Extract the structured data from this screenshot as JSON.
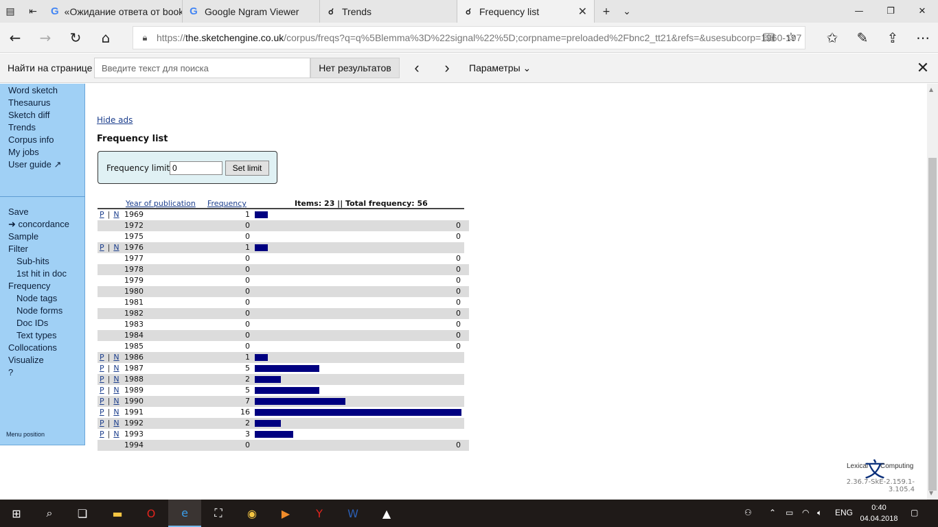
{
  "tabs": [
    {
      "title": "«Ожидание ответа от book",
      "icon": "google-g-icon",
      "active": false
    },
    {
      "title": "Google Ngram Viewer",
      "icon": "google-g-icon",
      "active": false
    },
    {
      "title": "Trends",
      "icon": "sketchengine-icon",
      "active": false
    },
    {
      "title": "Frequency list",
      "icon": "sketchengine-icon",
      "active": true
    }
  ],
  "address": {
    "prefix": "https://",
    "host": "the.sketchengine.co.uk",
    "path": "/corpus/freqs?q=q%5Blemma%3D%22signal%22%5D;corpname=preloaded%2Fbnc2_tt21&refs=&usesubcorp=1960-197"
  },
  "findbar": {
    "label": "Найти на странице",
    "placeholder": "Введите текст для поиска",
    "result": "Нет результатов",
    "options": "Параметры"
  },
  "sidebar": {
    "items": [
      {
        "label": "Word sketch",
        "sub": false
      },
      {
        "label": "Thesaurus",
        "sub": false
      },
      {
        "label": "Sketch diff",
        "sub": false
      },
      {
        "label": "Trends",
        "sub": false
      },
      {
        "label": "Corpus info",
        "sub": false
      },
      {
        "label": "My jobs",
        "sub": false
      },
      {
        "label": "User guide ↗",
        "sub": false
      }
    ],
    "items2": [
      {
        "label": "Save",
        "sub": false
      },
      {
        "label": "➜ concordance",
        "sub": false
      },
      {
        "label": "Sample",
        "sub": false
      },
      {
        "label": "Filter",
        "sub": false
      },
      {
        "label": "Sub-hits",
        "sub": true
      },
      {
        "label": "1st hit in doc",
        "sub": true
      },
      {
        "label": "Frequency",
        "sub": false
      },
      {
        "label": "Node tags",
        "sub": true
      },
      {
        "label": "Node forms",
        "sub": true
      },
      {
        "label": "Doc IDs",
        "sub": true
      },
      {
        "label": "Text types",
        "sub": true
      },
      {
        "label": "Collocations",
        "sub": false
      },
      {
        "label": "Visualize",
        "sub": false
      },
      {
        "label": "?",
        "sub": false
      }
    ],
    "menu_position": "Menu position"
  },
  "page": {
    "hide_ads": "Hide ads",
    "title": "Frequency list",
    "limit_label": "Frequency limit:",
    "limit_value": "0",
    "limit_button": "Set limit"
  },
  "table": {
    "col_year": "Year of publication",
    "col_freq": "Frequency",
    "summary": "Items: 23 || Total frequency: 56",
    "p_label": "P",
    "n_label": "N",
    "max": 16,
    "rows": [
      {
        "year": "1969",
        "freq": 1
      },
      {
        "year": "1972",
        "freq": 0
      },
      {
        "year": "1975",
        "freq": 0
      },
      {
        "year": "1976",
        "freq": 1
      },
      {
        "year": "1977",
        "freq": 0
      },
      {
        "year": "1978",
        "freq": 0
      },
      {
        "year": "1979",
        "freq": 0
      },
      {
        "year": "1980",
        "freq": 0
      },
      {
        "year": "1981",
        "freq": 0
      },
      {
        "year": "1982",
        "freq": 0
      },
      {
        "year": "1983",
        "freq": 0
      },
      {
        "year": "1984",
        "freq": 0
      },
      {
        "year": "1985",
        "freq": 0
      },
      {
        "year": "1986",
        "freq": 1
      },
      {
        "year": "1987",
        "freq": 5
      },
      {
        "year": "1988",
        "freq": 2
      },
      {
        "year": "1989",
        "freq": 5
      },
      {
        "year": "1990",
        "freq": 7
      },
      {
        "year": "1991",
        "freq": 16
      },
      {
        "year": "1992",
        "freq": 2
      },
      {
        "year": "1993",
        "freq": 3
      },
      {
        "year": "1994",
        "freq": 0
      }
    ]
  },
  "footer": {
    "logo_left": "Lexical",
    "logo_glyph": "文",
    "logo_right": "Computing",
    "version": "2.36.7-SkE-2.159.1-3.105.4"
  },
  "taskbar": {
    "lang": "ENG",
    "time": "0:40",
    "date": "04.04.2018"
  },
  "colors": {
    "bar": "#000080",
    "sidebar": "#a0d0f5",
    "row_alt": "#dcdcdc",
    "limit_box": "#e0f1f4"
  }
}
